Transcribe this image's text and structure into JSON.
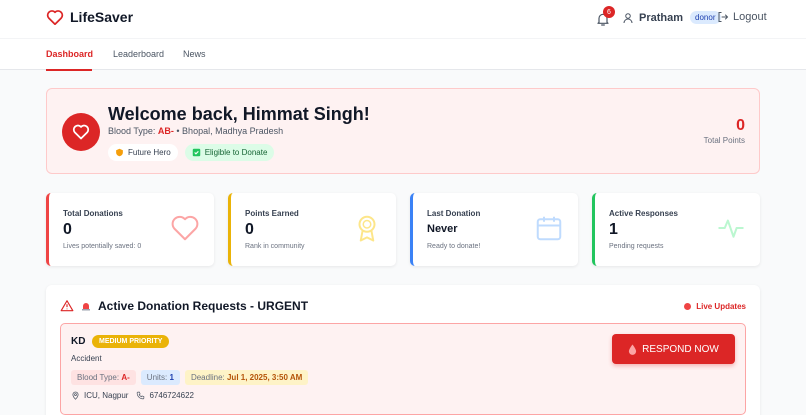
{
  "app": {
    "name": "LifeSaver"
  },
  "header": {
    "notifications_count": "6",
    "user_name": "Pratham",
    "user_role": "donor",
    "logout_label": "Logout"
  },
  "nav": {
    "tabs": [
      {
        "label": "Dashboard",
        "active": true
      },
      {
        "label": "Leaderboard",
        "active": false
      },
      {
        "label": "News",
        "active": false
      }
    ]
  },
  "welcome": {
    "title": "Welcome back, Himmat Singh!",
    "blood_type_label": "Blood Type:",
    "blood_type": "AB-",
    "location": "• Bhopal, Madhya Pradesh",
    "badge_hero": "Future Hero",
    "badge_eligible": "Eligible to Donate",
    "points_value": "0",
    "points_label": "Total Points"
  },
  "stats": [
    {
      "label": "Total Donations",
      "value": "0",
      "note": "Lives potentially saved: 0",
      "icon": "heart-icon",
      "color": "#ef4444"
    },
    {
      "label": "Points Earned",
      "value": "0",
      "note": "Rank in community",
      "icon": "award-icon",
      "color": "#eab308"
    },
    {
      "label": "Last Donation",
      "value": "Never",
      "note": "Ready to donate!",
      "icon": "calendar-icon",
      "color": "#3b82f6"
    },
    {
      "label": "Active Responses",
      "value": "1",
      "note": "Pending requests",
      "icon": "activity-icon",
      "color": "#22c55e"
    }
  ],
  "requests": {
    "title": "Active Donation Requests - URGENT",
    "live_label": "Live Updates",
    "items": [
      {
        "code": "KD",
        "priority": "MEDIUM PRIORITY",
        "type": "Accident",
        "blood_type_label": "Blood Type:",
        "blood_type": "A-",
        "units_label": "Units:",
        "units": "1",
        "deadline_label": "Deadline:",
        "deadline": "Jul 1, 2025, 3:50 AM",
        "location": "ICU, Nagpur",
        "phone": "6746724622",
        "respond_label": "RESPOND NOW"
      }
    ]
  },
  "colors": {
    "accent": "#dc2626",
    "accent_light": "#fef2f2"
  }
}
